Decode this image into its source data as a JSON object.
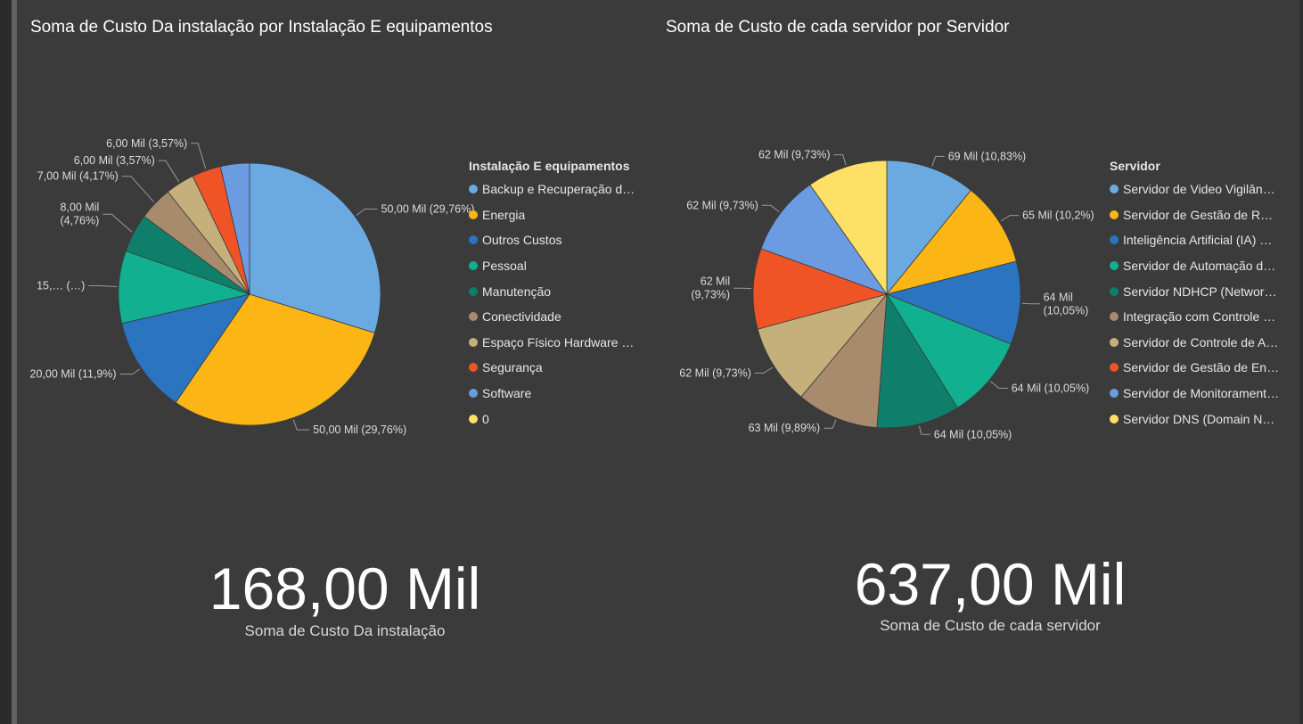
{
  "chart_data": [
    {
      "type": "pie",
      "title": "Soma de Custo Da instalação por Instalação E equipamentos",
      "legend_title": "Instalação E equipamentos",
      "legend_position": "right",
      "categories": [
        "Backup e Recuperação d…",
        "Energia",
        "Outros Custos",
        "Pessoal",
        "Manutenção",
        "Conectividade",
        "Espaço Físico Hardware …",
        "Segurança",
        "Software",
        "0"
      ],
      "values": [
        50000,
        50000,
        20000,
        15000,
        8000,
        7000,
        6000,
        6000,
        6000,
        0
      ],
      "colors": [
        "#6aaae0",
        "#fbb515",
        "#2a74c0",
        "#10b090",
        "#0f7f6b",
        "#a88a6c",
        "#c5b07c",
        "#ef5426",
        "#6b9be0",
        "#fde065"
      ],
      "data_labels": [
        "50,00 Mil (29,76%)",
        "50,00 Mil (29,76%)",
        "20,00 Mil (11,9%)",
        "15,… (…)",
        "8,00 Mil\n(4,76%)",
        "7,00 Mil (4,17%)",
        "6,00 Mil (3,57%)",
        "6,00 Mil (3,57%)",
        "",
        ""
      ]
    },
    {
      "type": "pie",
      "title": "Soma de Custo de cada servidor por Servidor",
      "legend_title": "Servidor",
      "legend_position": "right",
      "categories": [
        "Servidor de Video Vigilân…",
        "Servidor de Gestão de R…",
        "Inteligência Artificial (IA) …",
        "Servidor de Automação d…",
        "Servidor NDHCP (Networ…",
        "Integração com Controle …",
        "Servidor de Controle de A…",
        "Servidor de Gestão de En…",
        "Servidor de Monitorament…",
        "Servidor DNS (Domain N…"
      ],
      "values": [
        69000,
        65000,
        64000,
        64000,
        64000,
        63000,
        62000,
        62000,
        62000,
        62000
      ],
      "colors": [
        "#6aaae0",
        "#fbb515",
        "#2a74c0",
        "#10b090",
        "#0f7f6b",
        "#a88a6c",
        "#c5b07c",
        "#ef5426",
        "#6b9be0",
        "#fde065"
      ],
      "data_labels": [
        "69 Mil (10,83%)",
        "65 Mil (10,2%)",
        "64 Mil\n(10,05%)",
        "64 Mil (10,05%)",
        "64 Mil (10,05%)",
        "63 Mil (9,89%)",
        "62 Mil (9,73%)",
        "62 Mil\n(9,73%)",
        "62 Mil (9,73%)",
        "62 Mil (9,73%)"
      ]
    }
  ],
  "cards": [
    {
      "value": "168,00 Mil",
      "label": "Soma de Custo Da instalação"
    },
    {
      "value": "637,00 Mil",
      "label": "Soma de Custo de cada servidor"
    }
  ]
}
